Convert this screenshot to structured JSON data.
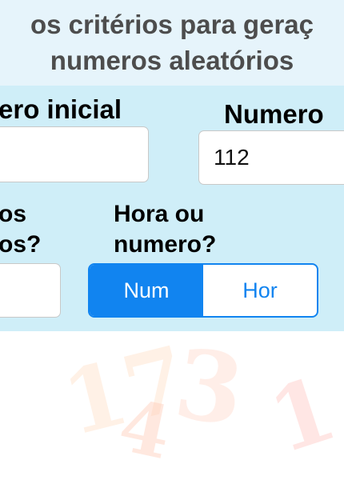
{
  "header": {
    "line1": "os critérios para geraç",
    "line2": "numeros aleatórios"
  },
  "fields": {
    "start_label": "ero inicial",
    "end_label": "Numero",
    "start_value": "",
    "end_value": "112",
    "count_label_line1": "os",
    "count_label_line2": "os?",
    "count_value": ""
  },
  "mode": {
    "label_line1": "Hora ou",
    "label_line2": "numero?",
    "options": [
      "Num",
      "Hor"
    ],
    "selected": "Num"
  },
  "background": {
    "digits": [
      "17",
      "4",
      "3",
      "1"
    ],
    "colors": {
      "accent": "#1184f0",
      "panel": "#cfeef8",
      "header": "#e6f4fb"
    }
  }
}
